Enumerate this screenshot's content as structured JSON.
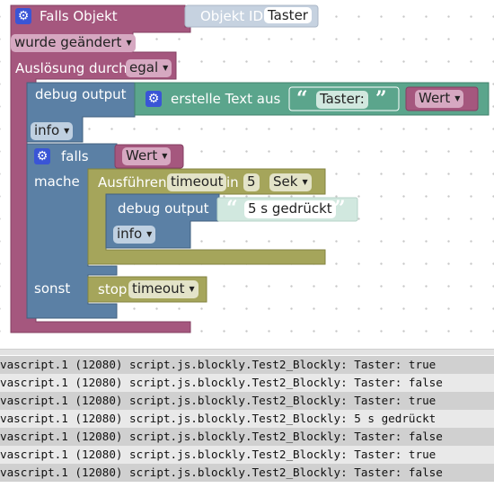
{
  "trigger": {
    "title": "Falls Objekt",
    "object_label": "Objekt ID",
    "object_value": "Taster",
    "change_value": "wurde geändert",
    "trigger_label": "Auslösung durch",
    "trigger_value": "egal"
  },
  "debug_outer": {
    "label": "debug output",
    "level": "info",
    "text_label": "erstelle Text aus",
    "string_value": "Taster:",
    "var_value": "Wert"
  },
  "if_block": {
    "if_label": "falls",
    "var_value": "Wert",
    "do_label": "mache",
    "else_label": "sonst"
  },
  "timeout_block": {
    "label": "Ausführen",
    "name": "timeout",
    "in_label": "in",
    "delay": "5",
    "unit": "Sek"
  },
  "debug_inner": {
    "label": "debug output",
    "text": "5 s gedrückt",
    "level": "info"
  },
  "stop_block": {
    "label": "stop",
    "name": "timeout"
  },
  "colors": {
    "event": "#a5577e",
    "logic": "#5b80a5",
    "timer": "#a5a55b",
    "text": "#5ba58c",
    "object": "#c6d2e0",
    "variable": "#a5577e"
  },
  "console": {
    "lines": [
      "vascript.1 (12080) script.js.blockly.Test2_Blockly: Taster: true",
      "vascript.1 (12080) script.js.blockly.Test2_Blockly: Taster: false",
      "vascript.1 (12080) script.js.blockly.Test2_Blockly: Taster: true",
      "vascript.1 (12080) script.js.blockly.Test2_Blockly: 5 s gedrückt",
      "vascript.1 (12080) script.js.blockly.Test2_Blockly: Taster: false",
      "vascript.1 (12080) script.js.blockly.Test2_Blockly: Taster: true",
      "vascript.1 (12080) script.js.blockly.Test2_Blockly: Taster: false"
    ]
  }
}
